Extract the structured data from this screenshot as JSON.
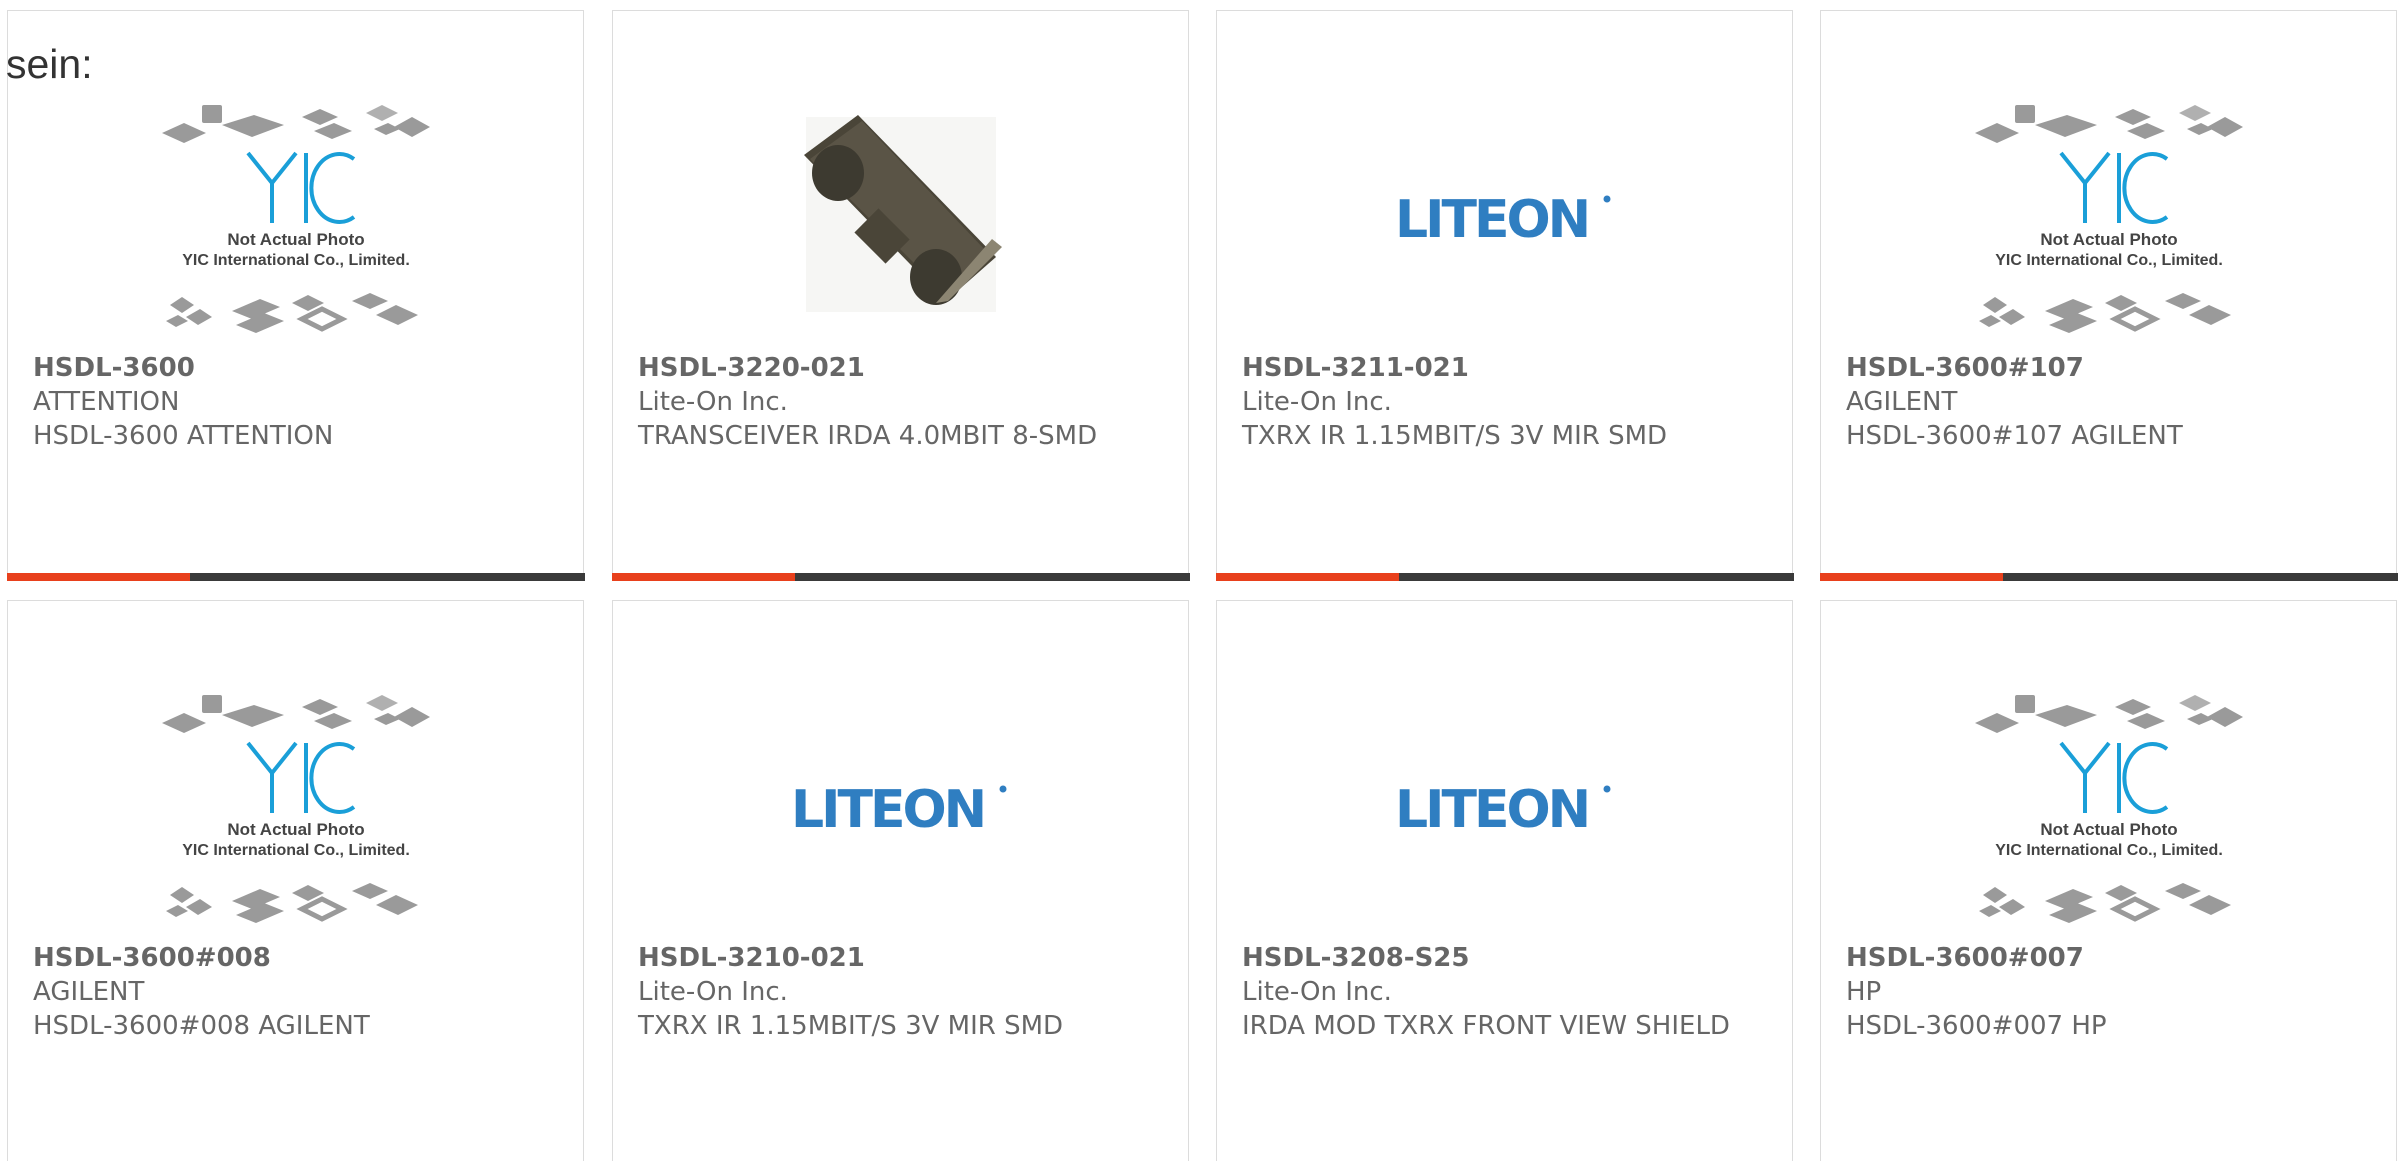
{
  "intro_text": "sein:",
  "colors": {
    "accent": "#e8401c",
    "bar": "#3a3a3a",
    "liteon_blue": "#2f7ec1",
    "yic_blue": "#1a9fd8"
  },
  "yic_placeholder": {
    "line1": "Not Actual Photo",
    "line2": "YIC International Co., Limited."
  },
  "products": [
    {
      "part_number": "HSDL-3600",
      "manufacturer": "ATTENTION",
      "description": "HSDL-3600 ATTENTION",
      "image": "yic-placeholder"
    },
    {
      "part_number": "HSDL-3220-021",
      "manufacturer": "Lite-On Inc.",
      "description": "TRANSCEIVER IRDA 4.0MBIT 8-SMD",
      "image": "component-photo"
    },
    {
      "part_number": "HSDL-3211-021",
      "manufacturer": "Lite-On Inc.",
      "description": "TXRX IR 1.15MBIT/S 3V MIR SMD",
      "image": "liteon-logo"
    },
    {
      "part_number": "HSDL-3600#107",
      "manufacturer": "AGILENT",
      "description": "HSDL-3600#107 AGILENT",
      "image": "yic-placeholder"
    },
    {
      "part_number": "HSDL-3600#008",
      "manufacturer": "AGILENT",
      "description": "HSDL-3600#008 AGILENT",
      "image": "yic-placeholder"
    },
    {
      "part_number": "HSDL-3210-021",
      "manufacturer": "Lite-On Inc.",
      "description": "TXRX IR 1.15MBIT/S 3V MIR SMD",
      "image": "liteon-logo"
    },
    {
      "part_number": "HSDL-3208-S25",
      "manufacturer": "Lite-On Inc.",
      "description": "IRDA MOD TXRX FRONT VIEW SHIELD",
      "image": "liteon-logo"
    },
    {
      "part_number": "HSDL-3600#007",
      "manufacturer": "HP",
      "description": "HSDL-3600#007 HP",
      "image": "yic-placeholder"
    }
  ]
}
